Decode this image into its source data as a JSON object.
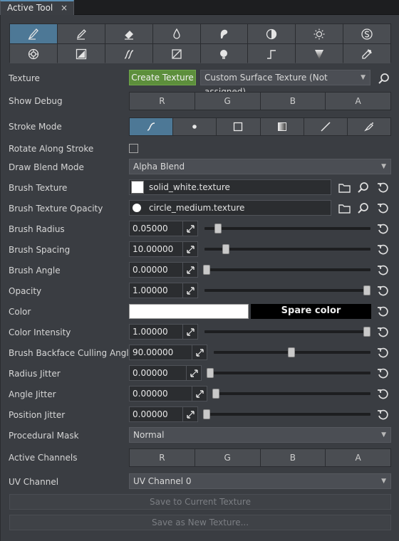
{
  "tab": {
    "title": "Active Tool",
    "close": "×"
  },
  "tools": [
    {
      "name": "paint-brush-icon",
      "active": true
    },
    {
      "name": "pencil-icon"
    },
    {
      "name": "eraser-icon"
    },
    {
      "name": "drop-icon"
    },
    {
      "name": "smudge-icon"
    },
    {
      "name": "contrast-icon"
    },
    {
      "name": "brightness-icon"
    },
    {
      "name": "clone-stamp-icon"
    },
    {
      "name": "target-icon"
    },
    {
      "name": "fill-layer-icon"
    },
    {
      "name": "curve-stroke-icon"
    },
    {
      "name": "square-slash-icon"
    },
    {
      "name": "bulb-icon"
    },
    {
      "name": "step-icon"
    },
    {
      "name": "gradient-cone-icon"
    },
    {
      "name": "eyedropper-icon"
    }
  ],
  "labels": {
    "texture": "Texture",
    "show_debug": "Show Debug",
    "stroke_mode": "Stroke Mode",
    "rotate_along_stroke": "Rotate Along Stroke",
    "draw_blend_mode": "Draw Blend Mode",
    "brush_texture": "Brush Texture",
    "brush_texture_opacity": "Brush Texture Opacity",
    "brush_radius": "Brush Radius",
    "brush_spacing": "Brush Spacing",
    "brush_angle": "Brush Angle",
    "opacity": "Opacity",
    "color": "Color",
    "color_intensity": "Color Intensity",
    "backface": "Brush Backface Culling Angle",
    "radius_jitter": "Radius Jitter",
    "angle_jitter": "Angle Jitter",
    "position_jitter": "Position Jitter",
    "procedural_mask": "Procedural Mask",
    "active_channels": "Active Channels",
    "uv_channel": "UV Channel"
  },
  "texture": {
    "create_button": "Create Texture",
    "selected": "Custom Surface Texture (Not assigned)"
  },
  "debug_channels": [
    "R",
    "G",
    "B",
    "A"
  ],
  "active_channels": [
    "R",
    "G",
    "B",
    "A"
  ],
  "stroke_modes": [
    "curve-stroke-icon",
    "dot-icon",
    "square-icon",
    "gradient-icon",
    "line-icon",
    "spray-icon"
  ],
  "rotate_along_stroke": false,
  "draw_blend_mode": "Alpha Blend",
  "brush_texture": "solid_white.texture",
  "brush_texture_opacity": "circle_medium.texture",
  "sliders": {
    "brush_radius": {
      "value": "0.05000",
      "fraction": 0.07
    },
    "brush_spacing": {
      "value": "10.00000",
      "fraction": 0.12
    },
    "brush_angle": {
      "value": "0.00000",
      "fraction": 0.0
    },
    "opacity": {
      "value": "1.00000",
      "fraction": 1.0
    },
    "color_intensity": {
      "value": "1.00000",
      "fraction": 1.0
    },
    "backface": {
      "value": "90.00000",
      "fraction": 0.5
    },
    "radius_jitter": {
      "value": "0.00000",
      "fraction": 0.0
    },
    "angle_jitter": {
      "value": "0.00000",
      "fraction": 0.0
    },
    "position_jitter": {
      "value": "0.00000",
      "fraction": 0.0
    }
  },
  "color": {
    "main": "#ffffff",
    "spare_label": "Spare color",
    "spare": "#000000"
  },
  "procedural_mask": "Normal",
  "uv_channel": "UV Channel 0",
  "buttons": {
    "save_current": "Save to Current Texture",
    "save_new": "Save as New Texture..."
  },
  "colors": {
    "accent": "#4d7896",
    "create_green": "#5d8f3c",
    "panel": "#3a3d42"
  }
}
